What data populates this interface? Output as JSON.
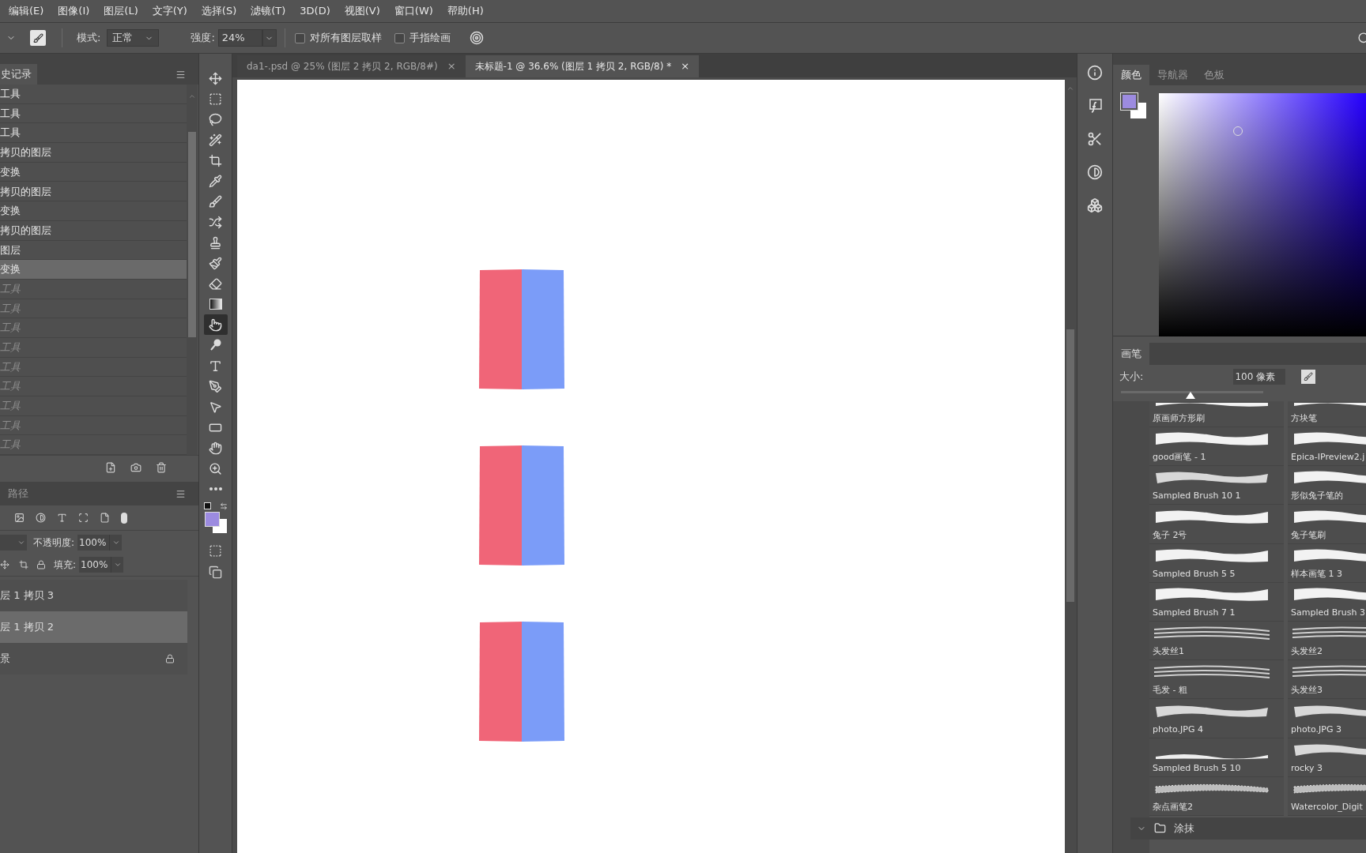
{
  "menu": [
    "编辑(E)",
    "图像(I)",
    "图层(L)",
    "文字(Y)",
    "选择(S)",
    "滤镜(T)",
    "3D(D)",
    "视图(V)",
    "窗口(W)",
    "帮助(H)"
  ],
  "options": {
    "mode_label": "模式:",
    "mode": "正常",
    "strength_label": "强度:",
    "strength": "24%",
    "sample_all": {
      "label": "对所有图层取样",
      "checked": false
    },
    "finger_paint": {
      "label": "手指绘画",
      "checked": false
    }
  },
  "history": {
    "title": "史记录",
    "items": [
      {
        "label": "工具",
        "selected": false,
        "disabled": false
      },
      {
        "label": "工具",
        "selected": false,
        "disabled": false
      },
      {
        "label": "工具",
        "selected": false,
        "disabled": false
      },
      {
        "label": "拷贝的图层",
        "selected": false,
        "disabled": false
      },
      {
        "label": "变换",
        "selected": false,
        "disabled": false
      },
      {
        "label": "拷贝的图层",
        "selected": false,
        "disabled": false
      },
      {
        "label": "变换",
        "selected": false,
        "disabled": false
      },
      {
        "label": "拷贝的图层",
        "selected": false,
        "disabled": false
      },
      {
        "label": "图层",
        "selected": false,
        "disabled": false
      },
      {
        "label": "变换",
        "selected": true,
        "disabled": false
      },
      {
        "label": "工具",
        "selected": false,
        "disabled": true
      },
      {
        "label": "工具",
        "selected": false,
        "disabled": true
      },
      {
        "label": "工具",
        "selected": false,
        "disabled": true
      },
      {
        "label": "工具",
        "selected": false,
        "disabled": true
      },
      {
        "label": "工具",
        "selected": false,
        "disabled": true
      },
      {
        "label": "工具",
        "selected": false,
        "disabled": true
      },
      {
        "label": "工具",
        "selected": false,
        "disabled": true
      },
      {
        "label": "工具",
        "selected": false,
        "disabled": true
      },
      {
        "label": "工具",
        "selected": false,
        "disabled": true
      }
    ]
  },
  "layers": {
    "tab": "路径",
    "opacity_label": "不透明度:",
    "opacity": "100%",
    "fill_label": "填充:",
    "fill": "100%",
    "items": [
      {
        "name": "层 1 拷贝 3",
        "selected": false,
        "locked": false
      },
      {
        "name": "层 1 拷贝 2",
        "selected": true,
        "locked": false
      },
      {
        "name": "景",
        "selected": false,
        "locked": true
      }
    ]
  },
  "tools": [
    {
      "kind": "move",
      "selected": false
    },
    {
      "kind": "marquee",
      "selected": false
    },
    {
      "kind": "lasso",
      "selected": false
    },
    {
      "kind": "wand",
      "selected": false
    },
    {
      "kind": "crop",
      "selected": false
    },
    {
      "kind": "eyedropper",
      "selected": false
    },
    {
      "kind": "brush",
      "selected": false
    },
    {
      "kind": "heal",
      "selected": false
    },
    {
      "kind": "stamp",
      "selected": false
    },
    {
      "kind": "history",
      "selected": false
    },
    {
      "kind": "eraser",
      "selected": false
    },
    {
      "kind": "gradient",
      "selected": false
    },
    {
      "kind": "smudge",
      "selected": true
    },
    {
      "kind": "dodge",
      "selected": false
    },
    {
      "kind": "type",
      "selected": false
    },
    {
      "kind": "pen",
      "selected": false
    },
    {
      "kind": "select",
      "selected": false
    },
    {
      "kind": "rect",
      "selected": false
    },
    {
      "kind": "hand",
      "selected": false
    },
    {
      "kind": "zoom",
      "selected": false
    },
    {
      "kind": "more",
      "selected": false
    }
  ],
  "doc_tabs": [
    {
      "title": "da1-.psd @ 25% (图层 2 拷贝 2, RGB/8#)",
      "close": "×",
      "selected": false
    },
    {
      "title": "未标题-1 @ 36.6% (图层 1 拷贝 2, RGB/8) *",
      "close": "×",
      "selected": true
    }
  ],
  "color_panel": {
    "tabs": [
      {
        "label": "颜色",
        "selected": true
      },
      {
        "label": "导航器",
        "selected": false
      },
      {
        "label": "色板",
        "selected": false
      }
    ]
  },
  "brush_panel": {
    "tab": "画笔",
    "size_label": "大小:",
    "size": "100 像素",
    "level": 0.49,
    "folder": "涂抹",
    "brushes": [
      {
        "name": "原画师方形刷",
        "kind": "solid"
      },
      {
        "name": "方块笔",
        "kind": "solid"
      },
      {
        "name": "good画笔 - 1",
        "kind": "solid"
      },
      {
        "name": "Epica-IPreview2.j",
        "kind": "solid"
      },
      {
        "name": "Sampled Brush 10 1",
        "kind": "textured"
      },
      {
        "name": "形似兔子笔的",
        "kind": "solid"
      },
      {
        "name": "兔子 2号",
        "kind": "solid"
      },
      {
        "name": "兔子笔刷",
        "kind": "solid"
      },
      {
        "name": "Sampled Brush 5 5",
        "kind": "solid"
      },
      {
        "name": "样本画笔 1 3",
        "kind": "solid"
      },
      {
        "name": "Sampled Brush 7 1",
        "kind": "solid"
      },
      {
        "name": "Sampled Brush 3",
        "kind": "solid"
      },
      {
        "name": "头发丝1",
        "kind": "hair"
      },
      {
        "name": "头发丝2",
        "kind": "hair"
      },
      {
        "name": "毛发 - 粗",
        "kind": "hair"
      },
      {
        "name": "头发丝3",
        "kind": "hair"
      },
      {
        "name": "photo.JPG 4",
        "kind": "textured"
      },
      {
        "name": "photo.JPG 3",
        "kind": "textured"
      },
      {
        "name": "Sampled Brush 5 10",
        "kind": "thin"
      },
      {
        "name": "rocky 3",
        "kind": "textured"
      },
      {
        "name": "杂点画笔2",
        "kind": "speckled"
      },
      {
        "name": "Watercolor_Digit",
        "kind": "speckled"
      }
    ]
  }
}
